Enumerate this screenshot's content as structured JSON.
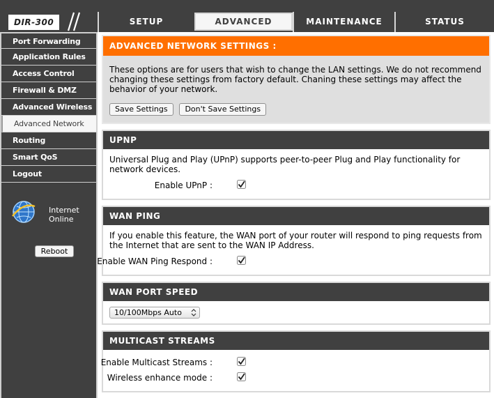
{
  "logo": {
    "model": "DIR-300"
  },
  "tabs": [
    {
      "label": "SETUP"
    },
    {
      "label": "ADVANCED"
    },
    {
      "label": "MAINTENANCE"
    },
    {
      "label": "STATUS"
    }
  ],
  "sidebar": {
    "items": [
      {
        "label": "Port Forwarding"
      },
      {
        "label": "Application Rules"
      },
      {
        "label": "Access Control"
      },
      {
        "label": "Firewall & DMZ"
      },
      {
        "label": "Advanced Wireless"
      },
      {
        "label": "Advanced Network"
      },
      {
        "label": "Routing"
      },
      {
        "label": "Smart QoS"
      },
      {
        "label": "Logout"
      }
    ],
    "status_line1": "Internet",
    "status_line2": "Online",
    "reboot_label": "Reboot"
  },
  "advanced": {
    "title": "ADVANCED NETWORK SETTINGS :",
    "description": "These options are for users that wish to change the LAN settings. We do not recommend changing these settings from factory default. Chaning these settings may affect the behavior of your network.",
    "save_label": "Save Settings",
    "dont_save_label": "Don't Save Settings"
  },
  "upnp": {
    "title": "UPNP",
    "description": "Universal Plug and Play (UPnP) supports peer-to-peer Plug and Play functionality for network devices.",
    "enable_label": "Enable UPnP :",
    "enabled": true
  },
  "wan_ping": {
    "title": "WAN PING",
    "description": "If you enable this feature, the WAN port of your router will respond to ping requests from the Internet that are sent to the WAN IP Address.",
    "enable_label": "Enable WAN Ping Respond :",
    "enabled": true
  },
  "wan_port_speed": {
    "title": "WAN PORT SPEED",
    "selected": "10/100Mbps Auto"
  },
  "multicast": {
    "title": "MULTICAST STREAMS",
    "enable_label": "Enable Multicast Streams :",
    "enabled": true,
    "wireless_label": "Wireless enhance mode :",
    "wireless_enabled": true
  },
  "colors": {
    "dark": "#404040",
    "orange": "#ff6f00",
    "panel_bg": "#dfdfdf"
  }
}
